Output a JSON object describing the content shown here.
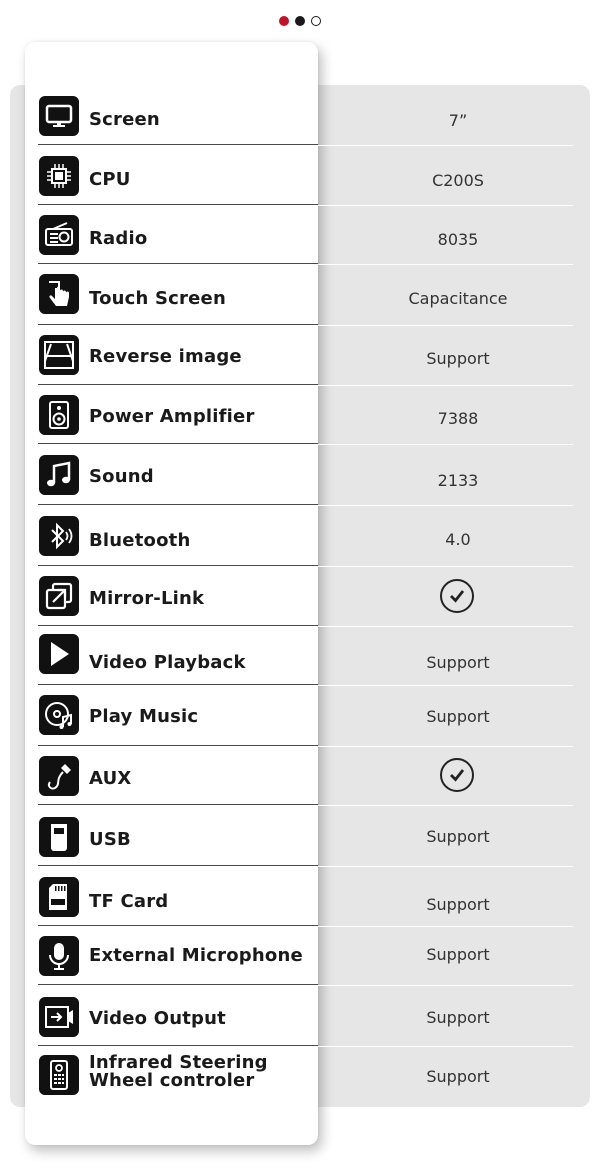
{
  "pager": {
    "active_color": "#c0142a"
  },
  "rows": [
    {
      "label": "Screen",
      "value": "7”",
      "icon": "monitor-icon"
    },
    {
      "label": "CPU",
      "value": "C200S",
      "icon": "cpu-chip-icon"
    },
    {
      "label": "Radio",
      "value": "8035",
      "icon": "radio-icon"
    },
    {
      "label": "Touch Screen",
      "value": "Capacitance",
      "icon": "touch-hand-icon"
    },
    {
      "label": "Reverse image",
      "value": "Support",
      "icon": "reverse-camera-icon"
    },
    {
      "label": "Power Amplifier",
      "value": "7388",
      "icon": "speaker-icon"
    },
    {
      "label": "Sound",
      "value": "2133",
      "icon": "music-note-icon"
    },
    {
      "label": "Bluetooth",
      "value": "4.0",
      "icon": "bluetooth-icon"
    },
    {
      "label": "Mirror-Link",
      "value": "",
      "check": true,
      "icon": "mirror-link-icon"
    },
    {
      "label": "Video Playback",
      "value": "Support",
      "icon": "play-icon"
    },
    {
      "label": "Play Music",
      "value": "Support",
      "icon": "music-disc-icon"
    },
    {
      "label": "AUX",
      "value": "",
      "check": true,
      "icon": "aux-cable-icon"
    },
    {
      "label": "USB",
      "value": "Support",
      "icon": "usb-icon"
    },
    {
      "label": "TF Card",
      "value": "Support",
      "icon": "sd-card-icon"
    },
    {
      "label": "External Microphone",
      "value": "Support",
      "icon": "microphone-icon"
    },
    {
      "label": "Video Output",
      "value": "Support",
      "icon": "video-output-icon"
    },
    {
      "label_line1": "Infrared Steering",
      "label_line2": "Wheel controler",
      "value": "Support",
      "icon": "remote-control-icon"
    }
  ]
}
